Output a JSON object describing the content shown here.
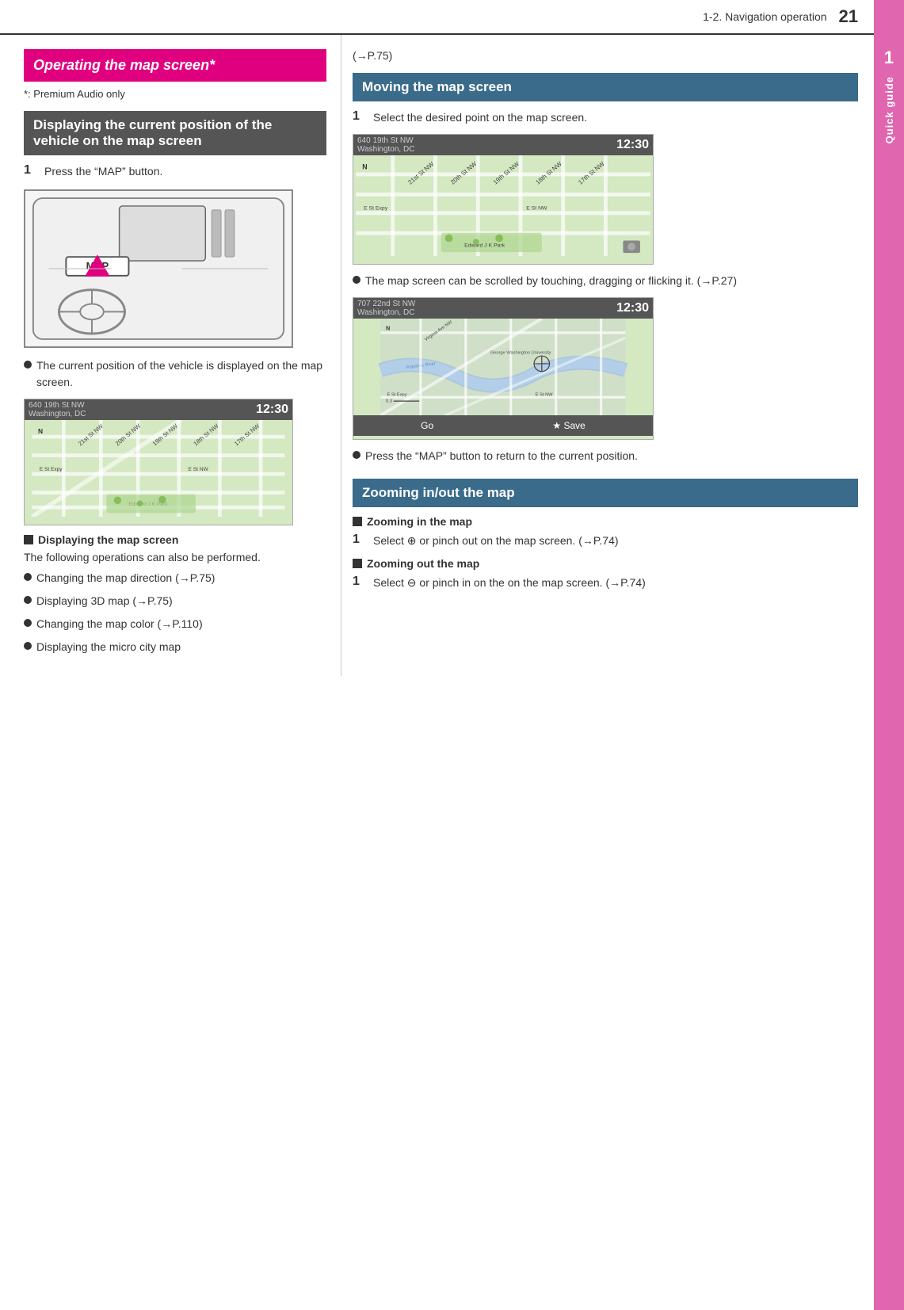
{
  "header": {
    "section": "1-2. Navigation operation",
    "page_num": "21"
  },
  "sidebar": {
    "number": "1",
    "label": "Quick guide"
  },
  "left_col": {
    "heading_pink": "Operating the map screen*",
    "asterisk_note": "*: Premium Audio only",
    "heading_dark": "Displaying the current position of the vehicle on the map screen",
    "step1_label": "1",
    "step1_text": "Press the “MAP” button.",
    "map_button_text": "MAP",
    "bullet1": "The current position of the vehicle is displayed on the map screen.",
    "map1_street": "640 19th St NW",
    "map1_city": "Washington, DC",
    "map1_time": "12:30",
    "sub_section": "Displaying the map screen",
    "following_text": "The following operations can also be performed.",
    "bullet2": "Changing the map direction (→P.75)",
    "bullet3": "Displaying 3D map (→P.75)",
    "bullet4": "Changing the map color (→P.110)",
    "bullet5": "Displaying the micro city map"
  },
  "right_col": {
    "ref_link": "(→P.75)",
    "heading_moving": "Moving the map screen",
    "step1_label": "1",
    "step1_text": "Select the desired point on the map screen.",
    "map2_street": "640 19th St NW",
    "map2_city": "Washington, DC",
    "map2_time": "12:30",
    "bullet_scroll": "The map screen can be scrolled by touching, dragging or flicking it. (→P.27)",
    "map3_street": "707 22nd St NW",
    "map3_city": "Washington, DC",
    "map3_time": "12:30",
    "map3_go": "Go",
    "map3_save": "★ Save",
    "bullet_map_btn": "Press the “MAP” button to return to the current position.",
    "heading_zoom": "Zooming in/out the map",
    "sub_zoom_in": "Zooming in the map",
    "zoom_in_step_label": "1",
    "zoom_in_step_text": "Select ⊕ or pinch out on the map screen. (→P.74)",
    "sub_zoom_out": "Zooming out the map",
    "zoom_out_step_label": "1",
    "zoom_out_step_text": "Select ⊖ or pinch in on the on the map screen. (→P.74)"
  }
}
